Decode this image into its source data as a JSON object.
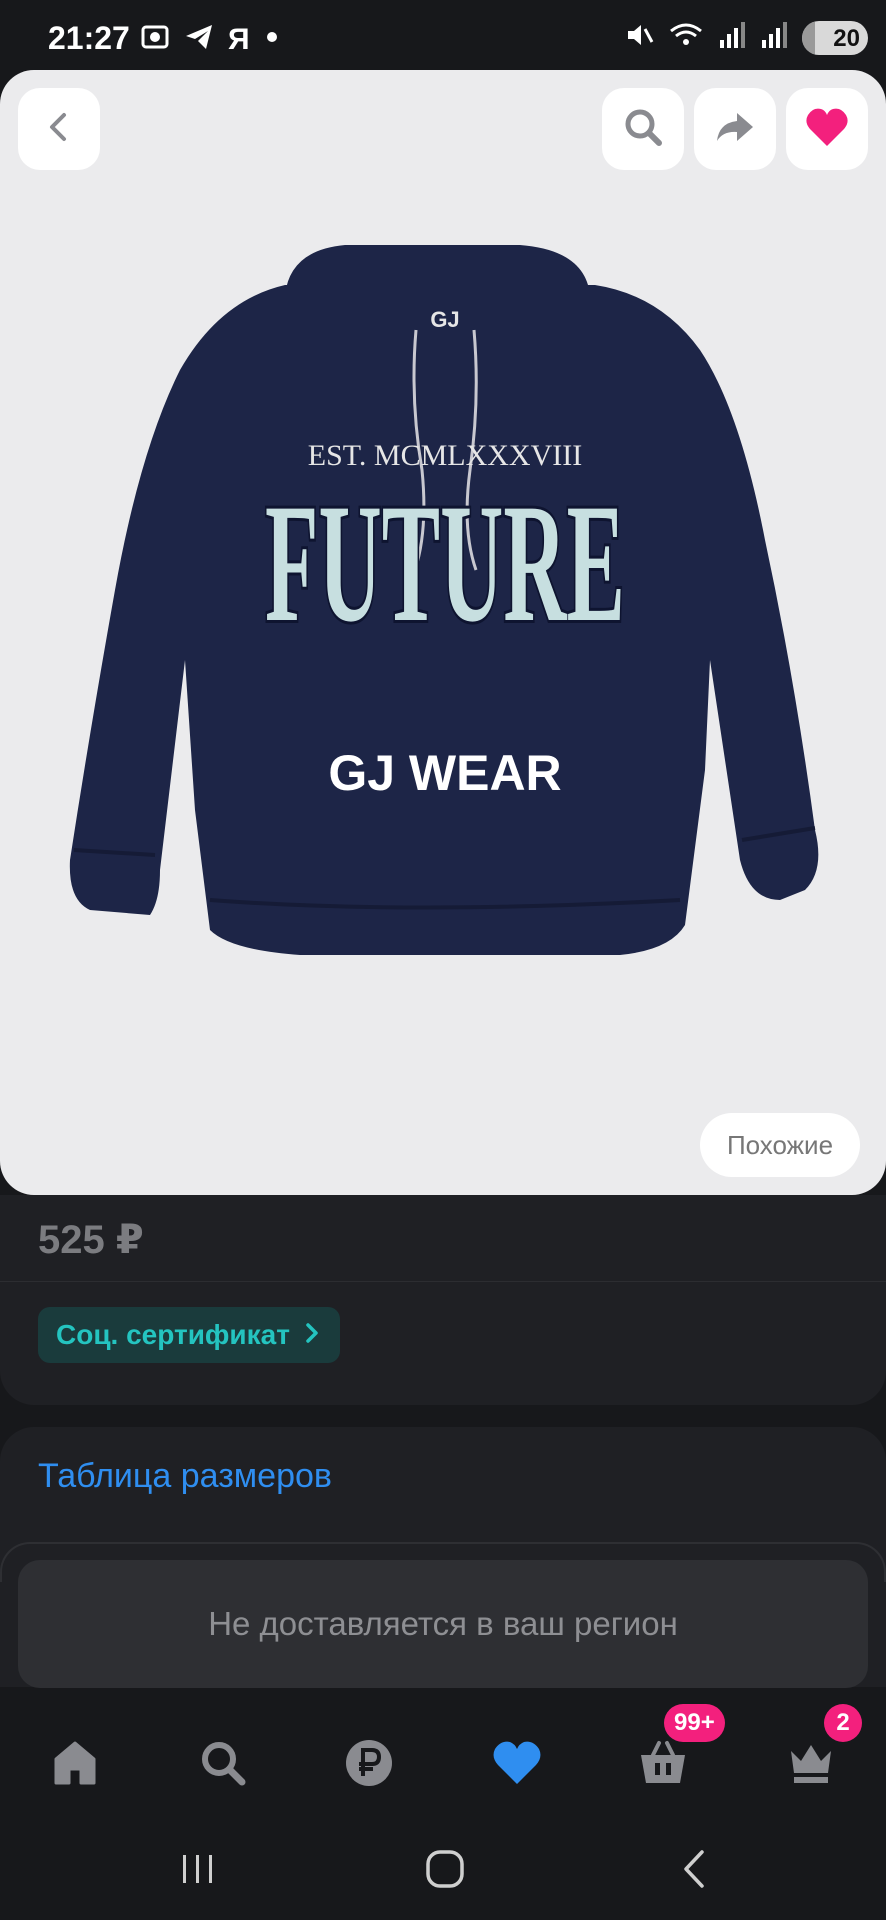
{
  "status_bar": {
    "time": "21:27",
    "yandex_glyph": "Я",
    "battery_level": "20",
    "battery_fraction": 0.2,
    "icons": [
      "screenshot-icon",
      "telegram-icon",
      "yandex-icon",
      "dot-icon",
      "mute-icon",
      "wifi-icon",
      "signal-icon",
      "signal-icon",
      "battery-icon"
    ]
  },
  "product": {
    "image_alt": "hoodie-image",
    "hoodie_print": {
      "est_line": "EST. MCMLXXXVIII",
      "big_word": "FUTURE",
      "brand_line": "GJ WEAR",
      "neck_label": "GJ"
    },
    "similar_label": "Похожие",
    "price": "525 ₽",
    "certificate_label": "Соц. сертификат"
  },
  "size_table_label": "Таблица размеров",
  "delivery_notice": "Не доставляется в ваш регион",
  "bottom_nav": {
    "items": [
      "home",
      "search",
      "ruble",
      "favorites",
      "cart",
      "profile"
    ],
    "cart_badge": "99+",
    "profile_badge": "2"
  },
  "colors": {
    "background": "#17181b",
    "card": "#1f2024",
    "accent_pink": "#f3207d",
    "accent_blue": "#2f8ef0",
    "teal": "#24c4c0",
    "hoodie": "#1d2547"
  }
}
